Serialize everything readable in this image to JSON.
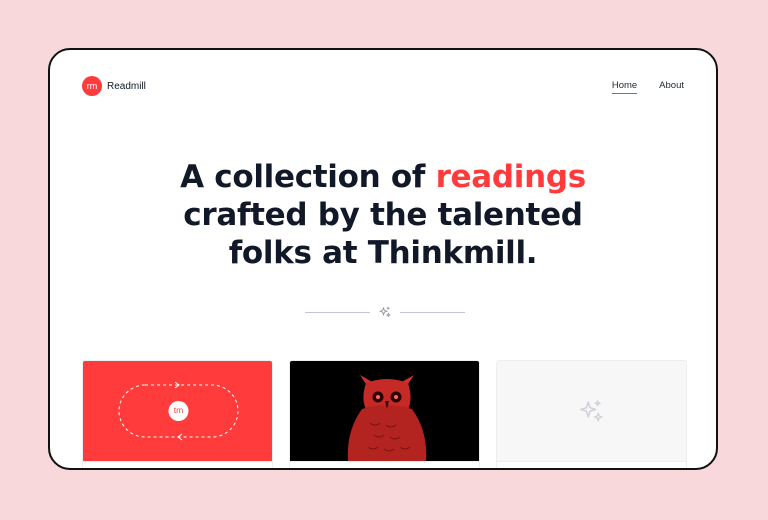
{
  "brand": {
    "logo_text": "rm",
    "name": "Readmill"
  },
  "nav": {
    "items": [
      {
        "label": "Home",
        "active": true
      },
      {
        "label": "About",
        "active": false
      }
    ]
  },
  "hero": {
    "line1_prefix": "A collection of ",
    "line1_accent": "readings",
    "line2": "crafted by the talented",
    "line3": "folks at Thinkmill."
  },
  "divider": {
    "icon": "sparkle-icon"
  },
  "cards": [
    {
      "logo_text": "tm",
      "background": "#ff3b3b"
    },
    {
      "image": "owl-image",
      "background": "#000000"
    },
    {
      "icon": "sparkle-icon",
      "background": "#f7f7f8"
    }
  ],
  "colors": {
    "accent": "#ff3b3b",
    "page_bg": "#f8d8da",
    "text": "#111827"
  }
}
